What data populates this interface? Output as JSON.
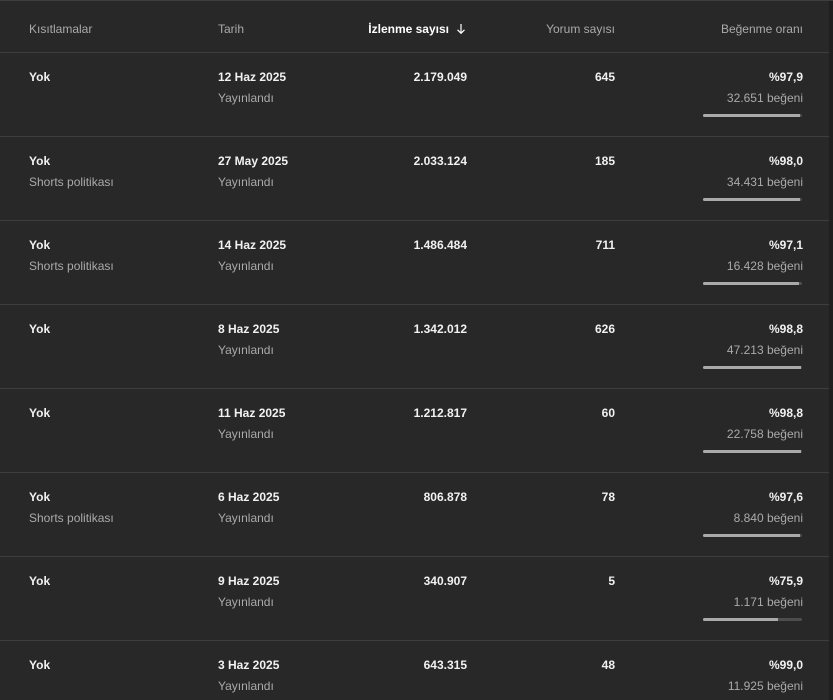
{
  "header": {
    "restrictions": "Kısıtlamalar",
    "date": "Tarih",
    "views": "İzlenme sayısı",
    "comments": "Yorum sayısı",
    "like_ratio": "Beğenme oranı",
    "sort_icon": "arrow-down-icon"
  },
  "rows": [
    {
      "restriction": "Yok",
      "restriction_note": "",
      "date": "12 Haz 2025",
      "status": "Yayınlandı",
      "views": "2.179.049",
      "comments": "645",
      "ratio": "%97,9",
      "likes": "32.651 beğeni",
      "ratio_value": 0.979
    },
    {
      "restriction": "Yok",
      "restriction_note": "Shorts politikası",
      "date": "27 May 2025",
      "status": "Yayınlandı",
      "views": "2.033.124",
      "comments": "185",
      "ratio": "%98,0",
      "likes": "34.431 beğeni",
      "ratio_value": 0.98
    },
    {
      "restriction": "Yok",
      "restriction_note": "Shorts politikası",
      "date": "14 Haz 2025",
      "status": "Yayınlandı",
      "views": "1.486.484",
      "comments": "711",
      "ratio": "%97,1",
      "likes": "16.428 beğeni",
      "ratio_value": 0.971
    },
    {
      "restriction": "Yok",
      "restriction_note": "",
      "date": "8 Haz 2025",
      "status": "Yayınlandı",
      "views": "1.342.012",
      "comments": "626",
      "ratio": "%98,8",
      "likes": "47.213 beğeni",
      "ratio_value": 0.988
    },
    {
      "restriction": "Yok",
      "restriction_note": "",
      "date": "11 Haz 2025",
      "status": "Yayınlandı",
      "views": "1.212.817",
      "comments": "60",
      "ratio": "%98,8",
      "likes": "22.758 beğeni",
      "ratio_value": 0.988
    },
    {
      "restriction": "Yok",
      "restriction_note": "Shorts politikası",
      "date": "6 Haz 2025",
      "status": "Yayınlandı",
      "views": "806.878",
      "comments": "78",
      "ratio": "%97,6",
      "likes": "8.840 beğeni",
      "ratio_value": 0.976
    },
    {
      "restriction": "Yok",
      "restriction_note": "",
      "date": "9 Haz 2025",
      "status": "Yayınlandı",
      "views": "340.907",
      "comments": "5",
      "ratio": "%75,9",
      "likes": "1.171 beğeni",
      "ratio_value": 0.759
    },
    {
      "restriction": "Yok",
      "restriction_note": "",
      "date": "3 Haz 2025",
      "status": "Yayınlandı",
      "views": "643.315",
      "comments": "48",
      "ratio": "%99,0",
      "likes": "11.925 beğeni",
      "ratio_value": 0.99
    }
  ],
  "colors": {
    "background": "#282828",
    "divider": "#3e3e3e",
    "muted_text": "#aaaaaa",
    "bar_fill": "#aaaaaa",
    "bar_track": "#4d4d4d"
  }
}
